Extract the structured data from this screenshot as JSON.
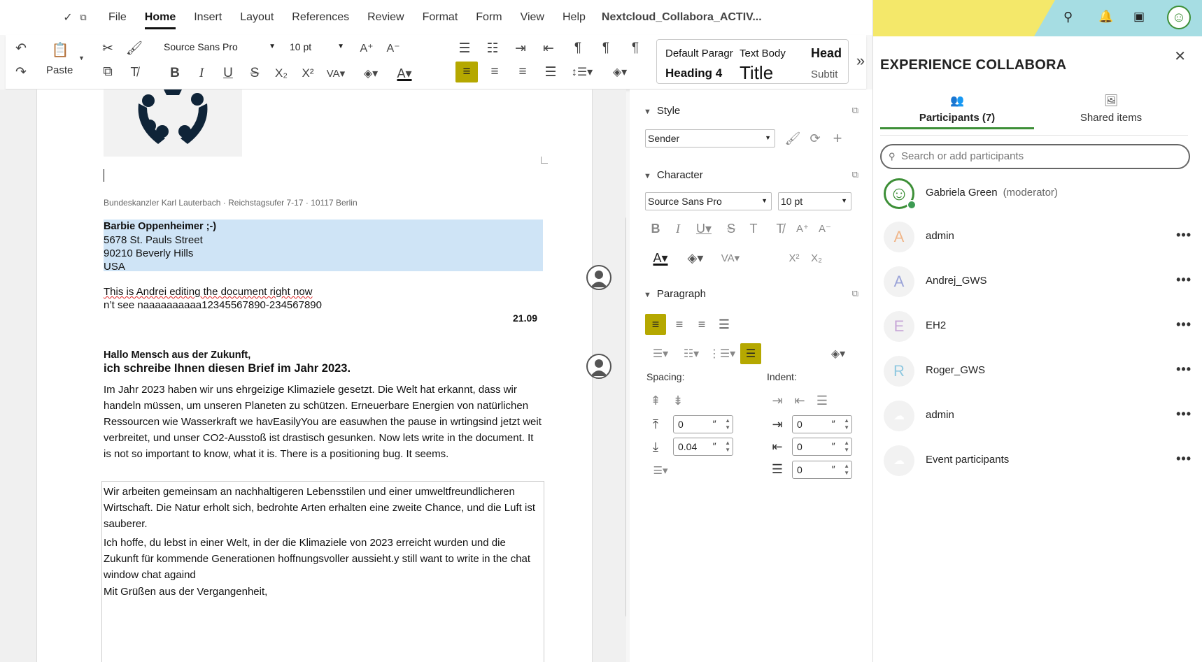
{
  "menu": {
    "items": [
      "File",
      "Home",
      "Insert",
      "Layout",
      "References",
      "Review",
      "Format",
      "Form",
      "View",
      "Help"
    ],
    "active": "Home",
    "doc_title": "Nextcloud_Collabora_ACTIV..."
  },
  "toolbar": {
    "paste_label": "Paste",
    "font_name": "Source Sans Pro",
    "font_size": "10 pt",
    "styles": [
      "Default Paragr",
      "Text Body",
      "Head",
      "Heading 4",
      "Title",
      "Subtit"
    ]
  },
  "document": {
    "sender_line": "Bundeskanzler Karl Lauterbach · Reichstagsufer 7-17  ·  10117 Berlin",
    "recipient": [
      "Barbie Oppenheimer   ;-)",
      "5678 St. Pauls Street",
      "90210 Beverly Hills",
      "USA"
    ],
    "edit_line1": "This is Andrei editing the document right now",
    "edit_line2": "n’t see naaaaaaaaaa12345567890-234567890",
    "date": "21.09",
    "greeting": "Hallo Mensch aus der Zukunft,",
    "subhead": "ich schreibe Ihnen diesen Brief im Jahr 2023.",
    "para1": "Im Jahr 2023 haben wir uns ehrgeizige Klimaziele gesetzt. Die Welt hat erkannt, dass wir handeln müssen, um unseren Planeten zu schützen. Erneuerbare Energien von natürlichen Ressourcen wie Wasserkraft we havEasilyYou are easuwhen the pause in wrtingsind jetzt weit verbreitet, und unser CO2-Ausstoß ist drastisch gesunken. Now lets write in the document. It is not so important to know, what it is. There is a positioning bug. It seems.",
    "para2": "Wir arbeiten gemeinsam an nachhaltigeren Lebensstilen und einer umweltfreundlicheren Wirtschaft. Die Natur erholt sich, bedrohte Arten erhalten eine zweite Chance, und die Luft ist sauberer.",
    "para3": "Ich hoffe, du lebst in einer Welt, in der die Klimaziele von 2023 erreicht wurden und die Zukunft für kommende Generationen hoffnungsvoller aussieht.y  still want to write in the chat window chat againd",
    "closing": "Mit Grüßen aus der Vergangenheit,"
  },
  "sidebar": {
    "style_title": "Style",
    "style_value": "Sender",
    "character_title": "Character",
    "char_font": "Source Sans Pro",
    "char_size": "10 pt",
    "paragraph_title": "Paragraph",
    "spacing_label": "Spacing:",
    "indent_label": "Indent:",
    "spacing_above": "0",
    "spacing_below": "0.04",
    "indent_before": "0",
    "indent_after": "0",
    "indent_first": "0",
    "unit": "″"
  },
  "panel": {
    "title": "EXPERIENCE COLLABORA",
    "tab_participants": "Participants (7)",
    "tab_shared": "Shared items",
    "search_placeholder": "Search or add participants",
    "participants": [
      {
        "initial": "",
        "name": "Gabriela Green",
        "role": "(moderator)"
      },
      {
        "initial": "A",
        "name": "admin",
        "role": ""
      },
      {
        "initial": "A",
        "name": "Andrej_GWS",
        "role": ""
      },
      {
        "initial": "E",
        "name": "EH2",
        "role": ""
      },
      {
        "initial": "R",
        "name": "Roger_GWS",
        "role": ""
      },
      {
        "initial": "",
        "name": "admin",
        "role": ""
      },
      {
        "initial": "",
        "name": "Event participants",
        "role": ""
      }
    ],
    "more": "•••"
  },
  "colors": {
    "accent": "#b5a800",
    "green": "#3d8f37",
    "selection": "#cfe4f6"
  }
}
